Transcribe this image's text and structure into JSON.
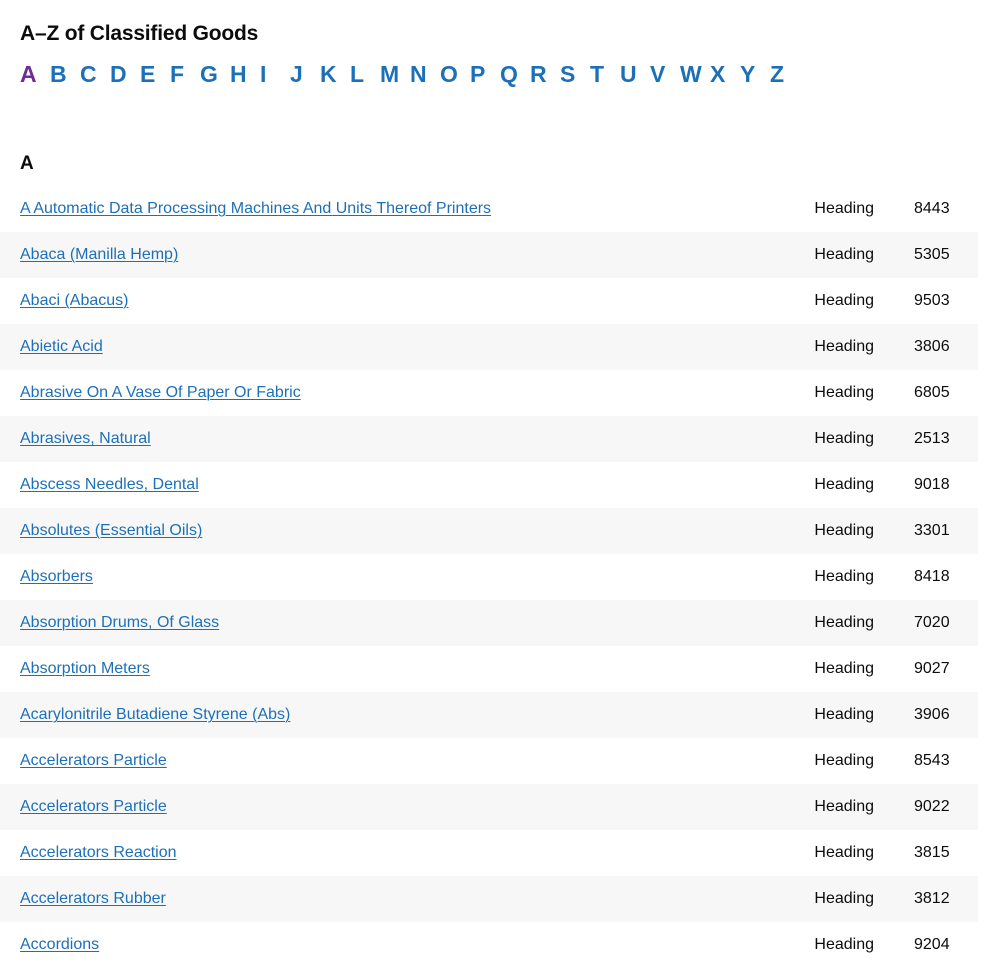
{
  "header": {
    "title": "A–Z of Classified Goods"
  },
  "alphabet_nav": {
    "active_letter": "A",
    "letters": [
      "A",
      "B",
      "C",
      "D",
      "E",
      "F",
      "G",
      "H",
      "I",
      "J",
      "K",
      "L",
      "M",
      "N",
      "O",
      "P",
      "Q",
      "R",
      "S",
      "T",
      "U",
      "V",
      "W",
      "X",
      "Y",
      "Z"
    ]
  },
  "section": {
    "heading": "A"
  },
  "colors": {
    "link": "#1d70b8",
    "visited_link": "#6f2c91",
    "text": "#0b0c0c",
    "row_alt_background": "#f7f7f7",
    "row_background": "#ffffff"
  },
  "results": [
    {
      "name": "A Automatic Data Processing Machines And Units Thereof Printers",
      "type": "Heading",
      "code": "8443"
    },
    {
      "name": "Abaca (Manilla Hemp)",
      "type": "Heading",
      "code": "5305"
    },
    {
      "name": "Abaci (Abacus)",
      "type": "Heading",
      "code": "9503"
    },
    {
      "name": "Abietic Acid",
      "type": "Heading",
      "code": "3806"
    },
    {
      "name": "Abrasive On A Vase Of Paper Or Fabric",
      "type": "Heading",
      "code": "6805"
    },
    {
      "name": "Abrasives, Natural",
      "type": "Heading",
      "code": "2513"
    },
    {
      "name": "Abscess Needles, Dental",
      "type": "Heading",
      "code": "9018"
    },
    {
      "name": "Absolutes (Essential Oils)",
      "type": "Heading",
      "code": "3301"
    },
    {
      "name": "Absorbers",
      "type": "Heading",
      "code": "8418"
    },
    {
      "name": "Absorption Drums, Of Glass",
      "type": "Heading",
      "code": "7020"
    },
    {
      "name": "Absorption Meters",
      "type": "Heading",
      "code": "9027"
    },
    {
      "name": "Acarylonitrile Butadiene Styrene (Abs)",
      "type": "Heading",
      "code": "3906"
    },
    {
      "name": "Accelerators Particle",
      "type": "Heading",
      "code": "8543"
    },
    {
      "name": "Accelerators Particle",
      "type": "Heading",
      "code": "9022"
    },
    {
      "name": "Accelerators Reaction",
      "type": "Heading",
      "code": "3815"
    },
    {
      "name": "Accelerators Rubber",
      "type": "Heading",
      "code": "3812"
    },
    {
      "name": "Accordions",
      "type": "Heading",
      "code": "9204"
    }
  ]
}
